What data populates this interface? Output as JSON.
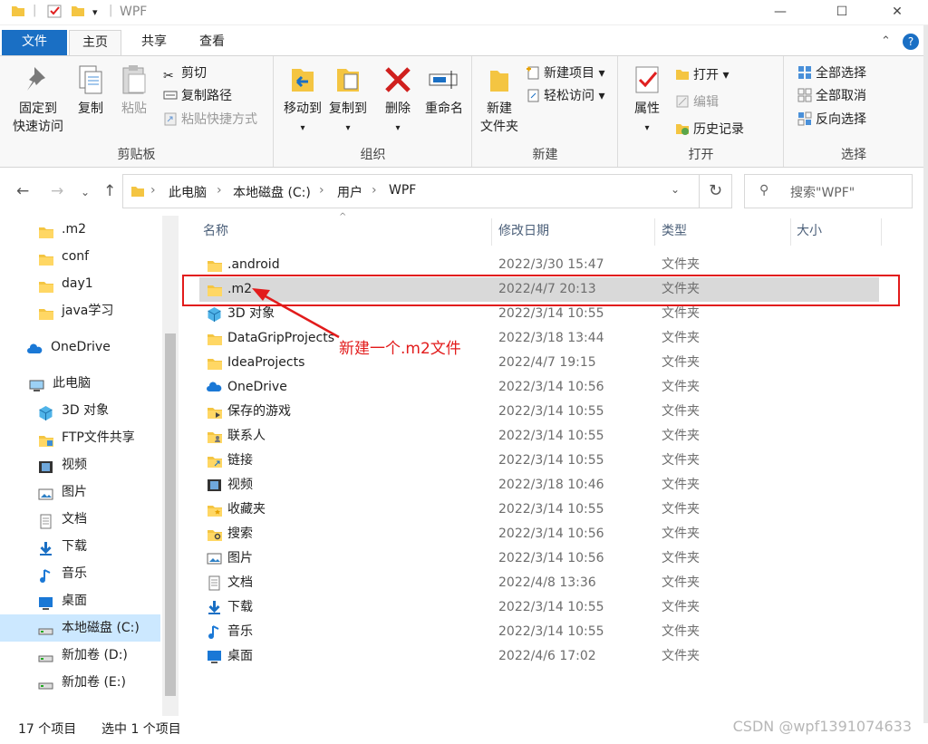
{
  "window": {
    "title": "WPF",
    "minimize": "—",
    "maximize": "☐",
    "close": "✕"
  },
  "tabs": {
    "file": "文件",
    "home": "主页",
    "share": "共享",
    "view": "查看"
  },
  "ribbon": {
    "clipboard": {
      "label": "剪贴板",
      "pin": "固定到\n快速访问",
      "pin_l1": "固定到",
      "pin_l2": "快速访问",
      "copy": "复制",
      "paste": "粘贴",
      "cut": "剪切",
      "copy_path": "复制路径",
      "paste_shortcut": "粘贴快捷方式"
    },
    "organize": {
      "label": "组织",
      "move_to": "移动到",
      "copy_to": "复制到",
      "delete": "删除",
      "rename": "重命名"
    },
    "new": {
      "label": "新建",
      "new_folder_l1": "新建",
      "new_folder_l2": "文件夹",
      "new_item": "新建项目",
      "easy_access": "轻松访问"
    },
    "open": {
      "label": "打开",
      "properties": "属性",
      "open": "打开",
      "edit": "编辑",
      "history": "历史记录"
    },
    "select": {
      "label": "选择",
      "select_all": "全部选择",
      "select_none": "全部取消",
      "invert": "反向选择"
    }
  },
  "address": {
    "crumbs": [
      "此电脑",
      "本地磁盘 (C:)",
      "用户",
      "WPF"
    ],
    "search_placeholder": "搜索\"WPF\""
  },
  "nav": {
    "items": [
      {
        "label": ".m2",
        "icon": "folder-icon"
      },
      {
        "label": "conf",
        "icon": "folder-icon"
      },
      {
        "label": "day1",
        "icon": "folder-icon"
      },
      {
        "label": "java学习",
        "icon": "folder-icon"
      },
      {
        "label": "OneDrive",
        "icon": "cloud-icon"
      },
      {
        "label": "此电脑",
        "icon": "computer-icon"
      },
      {
        "label": "3D 对象",
        "icon": "cube-icon"
      },
      {
        "label": "FTP文件共享",
        "icon": "network-folder-icon"
      },
      {
        "label": "视频",
        "icon": "video-icon"
      },
      {
        "label": "图片",
        "icon": "picture-icon"
      },
      {
        "label": "文档",
        "icon": "document-icon"
      },
      {
        "label": "下载",
        "icon": "download-icon"
      },
      {
        "label": "音乐",
        "icon": "music-icon"
      },
      {
        "label": "桌面",
        "icon": "desktop-icon"
      },
      {
        "label": "本地磁盘 (C:)",
        "icon": "drive-icon"
      },
      {
        "label": "新加卷 (D:)",
        "icon": "drive-icon"
      },
      {
        "label": "新加卷 (E:)",
        "icon": "drive-icon"
      }
    ]
  },
  "columns": {
    "name": "名称",
    "modified": "修改日期",
    "type": "类型",
    "size": "大小"
  },
  "files": [
    {
      "name": ".android",
      "modified": "2022/3/30 15:47",
      "type": "文件夹",
      "icon": "folder-icon"
    },
    {
      "name": ".m2",
      "modified": "2022/4/7 20:13",
      "type": "文件夹",
      "icon": "folder-icon",
      "selected": true
    },
    {
      "name": "3D 对象",
      "modified": "2022/3/14 10:55",
      "type": "文件夹",
      "icon": "cube-icon"
    },
    {
      "name": "DataGripProjects",
      "modified": "2022/3/18 13:44",
      "type": "文件夹",
      "icon": "folder-icon"
    },
    {
      "name": "IdeaProjects",
      "modified": "2022/4/7 19:15",
      "type": "文件夹",
      "icon": "folder-icon"
    },
    {
      "name": "OneDrive",
      "modified": "2022/3/14 10:56",
      "type": "文件夹",
      "icon": "cloud-icon"
    },
    {
      "name": "保存的游戏",
      "modified": "2022/3/14 10:55",
      "type": "文件夹",
      "icon": "game-folder-icon"
    },
    {
      "name": "联系人",
      "modified": "2022/3/14 10:55",
      "type": "文件夹",
      "icon": "contacts-folder-icon"
    },
    {
      "name": "链接",
      "modified": "2022/3/14 10:55",
      "type": "文件夹",
      "icon": "links-folder-icon"
    },
    {
      "name": "视频",
      "modified": "2022/3/18 10:46",
      "type": "文件夹",
      "icon": "video-icon"
    },
    {
      "name": "收藏夹",
      "modified": "2022/3/14 10:55",
      "type": "文件夹",
      "icon": "favorites-folder-icon"
    },
    {
      "name": "搜索",
      "modified": "2022/3/14 10:56",
      "type": "文件夹",
      "icon": "search-folder-icon"
    },
    {
      "name": "图片",
      "modified": "2022/3/14 10:56",
      "type": "文件夹",
      "icon": "picture-icon"
    },
    {
      "name": "文档",
      "modified": "2022/4/8 13:36",
      "type": "文件夹",
      "icon": "document-icon"
    },
    {
      "name": "下载",
      "modified": "2022/3/14 10:55",
      "type": "文件夹",
      "icon": "download-icon"
    },
    {
      "name": "音乐",
      "modified": "2022/3/14 10:55",
      "type": "文件夹",
      "icon": "music-icon"
    },
    {
      "name": "桌面",
      "modified": "2022/4/6 17:02",
      "type": "文件夹",
      "icon": "desktop-icon"
    }
  ],
  "annotation": {
    "text": "新建一个.m2文件",
    "color": "#e21b1b"
  },
  "status": {
    "count": "17 个项目",
    "selected": "选中 1 个项目"
  },
  "watermark": "CSDN @wpf1391074633",
  "colors": {
    "accent": "#1a6fc4",
    "selection": "#cce8ff",
    "annotation": "#e21b1b"
  }
}
